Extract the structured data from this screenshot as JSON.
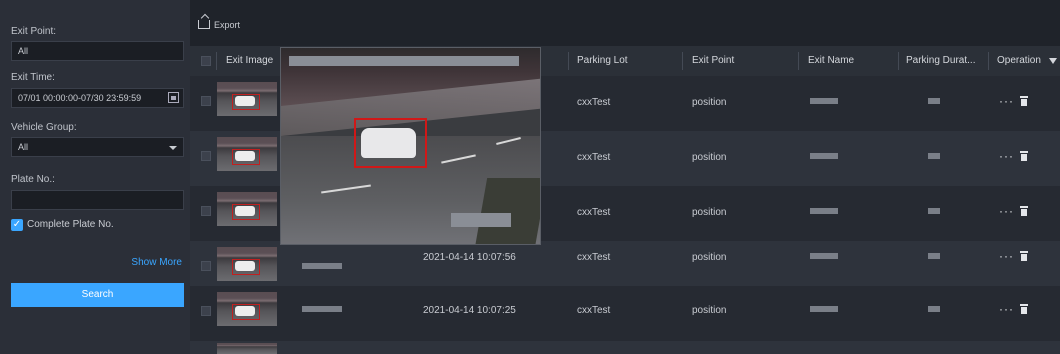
{
  "filters": {
    "exit_point_label": "Exit Point:",
    "exit_point_value": "All",
    "exit_time_label": "Exit Time:",
    "exit_time_value": "07/01 00:00:00-07/30 23:59:59",
    "vehicle_group_label": "Vehicle Group:",
    "vehicle_group_value": "All",
    "plate_label": "Plate No.:",
    "plate_value": "",
    "complete_plate_label": "Complete Plate No.",
    "complete_plate_checked": true,
    "show_more": "Show More",
    "search": "Search"
  },
  "toolbar": {
    "export": "Export"
  },
  "table": {
    "headers": {
      "exit_image": "Exit Image",
      "parking_lot": "Parking Lot",
      "exit_point": "Exit Point",
      "exit_name": "Exit Name",
      "parking_duration": "Parking Durat...",
      "operation": "Operation"
    },
    "rows": [
      {
        "exit_time": "",
        "parking_lot": "cxxTest",
        "exit_point": "position"
      },
      {
        "exit_time": "",
        "parking_lot": "cxxTest",
        "exit_point": "position"
      },
      {
        "exit_time": "",
        "parking_lot": "cxxTest",
        "exit_point": "position"
      },
      {
        "exit_time": "2021-04-14 10:07:56",
        "parking_lot": "cxxTest",
        "exit_point": "position"
      },
      {
        "exit_time": "2021-04-14 10:07:25",
        "parking_lot": "cxxTest",
        "exit_point": "position"
      }
    ],
    "operations_glyph": "···"
  },
  "colors": {
    "accent": "#3aa6ff",
    "highlight_box": "#d01818"
  }
}
